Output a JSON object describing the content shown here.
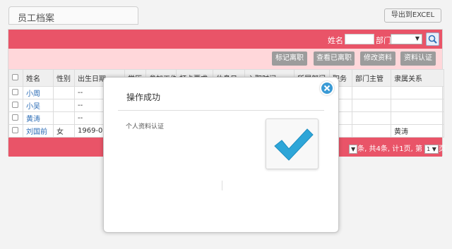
{
  "page": {
    "title": "员工档案",
    "export_label": "导出到EXCEL"
  },
  "search": {
    "name_label": "姓名",
    "name_value": "",
    "dept_label": "部门",
    "dept_value": "",
    "dept_arrow": "▼"
  },
  "actions": [
    {
      "label": "标记离职"
    },
    {
      "label": "查看已离职"
    },
    {
      "label": "修改资料"
    },
    {
      "label": "资料认证"
    }
  ],
  "table": {
    "columns": [
      "",
      "姓名",
      "性别",
      "出生日期",
      "学历",
      "参加工作",
      "打卡要求",
      "休息日",
      "入职时间",
      "所属部门",
      "职务",
      "部门主管",
      "隶属关系"
    ],
    "rows": [
      {
        "name": "小周",
        "gender": "",
        "birth": "--",
        "superior": ""
      },
      {
        "name": "小吴",
        "gender": "",
        "birth": "--",
        "superior": ""
      },
      {
        "name": "黄涛",
        "gender": "",
        "birth": "--",
        "superior": ""
      },
      {
        "name": "刘国前",
        "gender": "女",
        "birth": "1969-05",
        "superior": "黄涛"
      }
    ]
  },
  "pager": {
    "summary": "条, 共4条, 计1页, 第",
    "page_value": "1",
    "page_suffix": "页"
  },
  "dialog": {
    "title": "操作成功",
    "message": "个人资料认证"
  },
  "colors": {
    "accent_red": "#e95468",
    "action_bar_pink": "#ffd7da",
    "close_blue": "#3a9ad5",
    "check_blue": "#2ea6d8"
  }
}
